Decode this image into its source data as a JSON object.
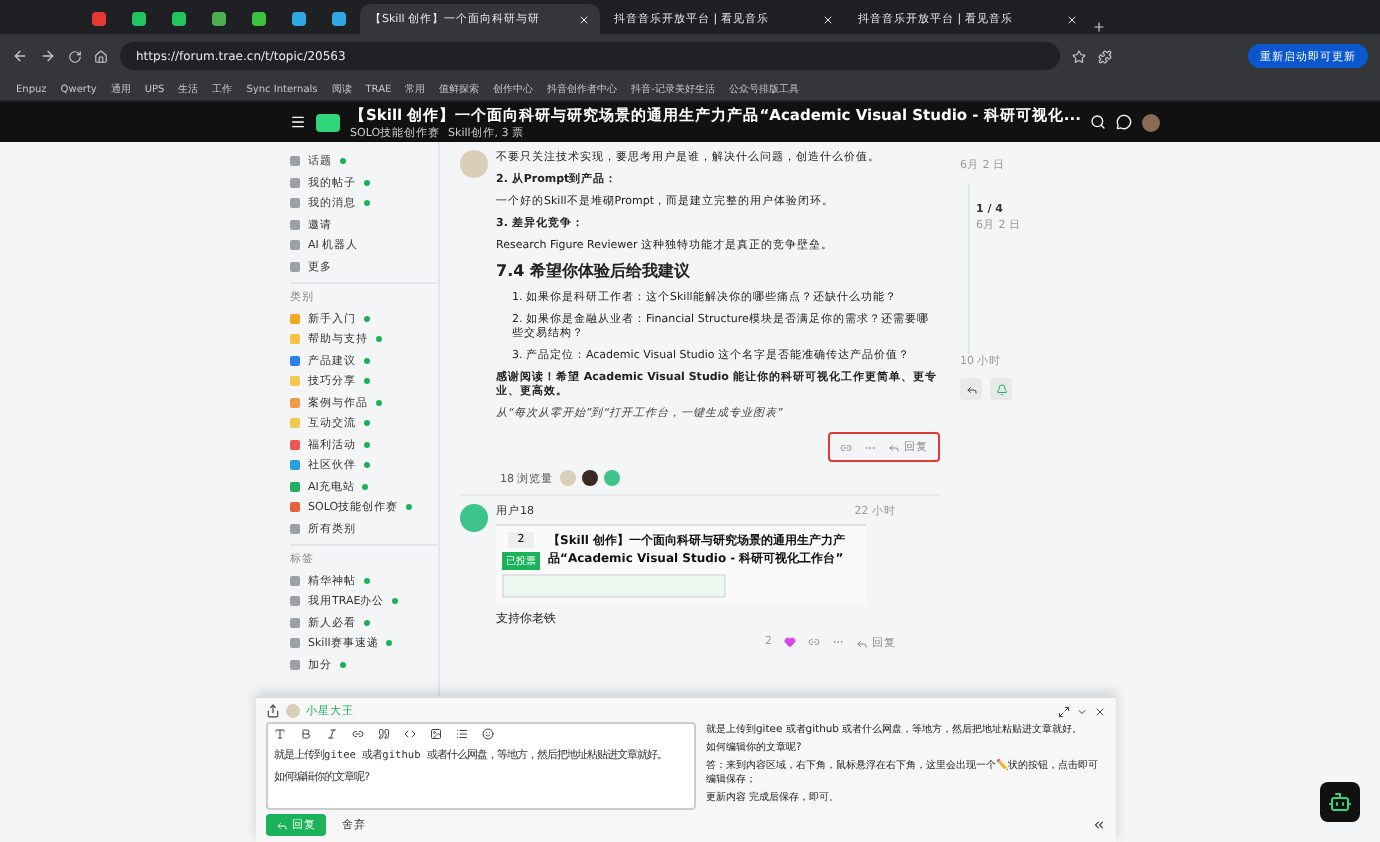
{
  "browser": {
    "pinned_tabs": [
      {
        "color": "#e53935"
      },
      {
        "color": "#22c55e"
      },
      {
        "color": "#22c55e"
      },
      {
        "color": "#4caf50"
      },
      {
        "color": "#3ec33e"
      },
      {
        "color": "#2fa7e0"
      },
      {
        "color": "#2fa7e0"
      }
    ],
    "tabs": [
      {
        "title": "【Skill 创作】一个面向科研与研",
        "selected": true
      },
      {
        "title": "抖音音乐开放平台 | 看见音乐",
        "selected": false
      },
      {
        "title": "抖音音乐开放平台 | 看见音乐",
        "selected": false
      }
    ],
    "url": "https://forum.trae.cn/t/topic/20563",
    "update_button": "重新启动即可更新",
    "bookmarks": [
      "Enpuz",
      "Qwerty",
      "通用",
      "UPS",
      "生活",
      "工作",
      "Sync Internals",
      "阅读",
      "TRAE",
      "常用",
      "值鲜探索",
      "创作中心",
      "抖音创作者中心",
      "抖音-记录美好生活",
      "公众号排版工具"
    ]
  },
  "header": {
    "title": "【Skill 创作】一个面向科研与研究场景的通用生产力产品“Academic Visual Studio - 科研可视化...",
    "category": "SOLO技能创作赛",
    "tags": "Skill创作, 3 票"
  },
  "sidebar": {
    "items": [
      {
        "label": "话题",
        "unread": true,
        "color": "#9aa0a6"
      },
      {
        "label": "我的帖子",
        "unread": true,
        "color": "#9aa0a6"
      },
      {
        "label": "我的消息",
        "unread": true,
        "color": "#9aa0a6"
      },
      {
        "label": "邀请",
        "unread": false,
        "color": "#9aa0a6"
      },
      {
        "label": "AI 机器人",
        "unread": false,
        "color": "#9aa0a6"
      },
      {
        "label": "更多",
        "unread": false,
        "color": "#9aa0a6"
      }
    ],
    "categories_heading": "类别",
    "categories": [
      {
        "label": "新手入门",
        "unread": true,
        "color": "#f5a623"
      },
      {
        "label": "帮助与支持",
        "unread": true,
        "color": "#f5c542"
      },
      {
        "label": "产品建议",
        "unread": true,
        "color": "#2f80ed"
      },
      {
        "label": "技巧分享",
        "unread": true,
        "color": "#f2c94c"
      },
      {
        "label": "案例与作品",
        "unread": true,
        "color": "#f2994a"
      },
      {
        "label": "互动交流",
        "unread": true,
        "color": "#f2c94c"
      },
      {
        "label": "福利活动",
        "unread": true,
        "color": "#eb5757"
      },
      {
        "label": "社区伙伴",
        "unread": true,
        "color": "#27a0e0"
      },
      {
        "label": "AI充电站",
        "unread": true,
        "color": "#27ae60"
      },
      {
        "label": "SOLO技能创作赛",
        "unread": true,
        "color": "#e8603c"
      },
      {
        "label": "所有类别",
        "unread": false,
        "color": "#9aa0a6"
      }
    ],
    "tags_heading": "标签",
    "tags": [
      {
        "label": "精华神帖",
        "unread": true
      },
      {
        "label": "我用TRAE办公",
        "unread": true
      },
      {
        "label": "新人必看",
        "unread": true
      },
      {
        "label": "Skill赛事速递",
        "unread": true
      },
      {
        "label": "加分",
        "unread": true
      }
    ]
  },
  "post": {
    "date": "6月 2 日",
    "paragraphs": [
      {
        "kind": "text",
        "text": "不要只关注技术实现，要思考用户是谁，解决什么问题，创造什么价值。"
      },
      {
        "kind": "bold",
        "text": "2. 从Prompt到产品："
      },
      {
        "kind": "text",
        "text": "一个好的Skill不是堆砌Prompt，而是建立完整的用户体验闭环。"
      },
      {
        "kind": "bold",
        "text": "3. 差异化竞争："
      },
      {
        "kind": "text",
        "text": "Research Figure Reviewer 这种独特功能才是真正的竞争壁垒。"
      },
      {
        "kind": "heading",
        "text": "7.4 希望你体验后给我建议"
      },
      {
        "kind": "list_item",
        "text": "1. 如果你是科研工作者：这个Skill能解决你的哪些痛点？还缺什么功能？"
      },
      {
        "kind": "list_item",
        "text": "2. 如果你是金融从业者：Financial Structure模块是否满足你的需求？还需要哪些交易结构？"
      },
      {
        "kind": "list_item",
        "text": "3. 产品定位：Academic Visual Studio 这个名字是否能准确传达产品价值？"
      },
      {
        "kind": "bold",
        "text": "感谢阅读！希望 Academic Visual Studio 能让你的科研可视化工作更简单、更专业、更高效。"
      },
      {
        "kind": "italic",
        "text": "从“每次从零开始”到“打开工作台，一键生成专业图表”"
      }
    ],
    "reply_label": "回复",
    "views": "18 浏览量"
  },
  "reply": {
    "user": "用户18",
    "time": "22 小时",
    "quote": {
      "votes": "2",
      "vote_button": "已投票",
      "title": "【Skill 创作】一个面向科研与研究场景的通用生产力产品“Academic Visual Studio - 科研可视化工作台”"
    },
    "text": "支持你老铁",
    "likes": "2",
    "reply_label": "回复"
  },
  "timeline": {
    "position": "1 / 4",
    "position_date": "6月 2 日",
    "bottom": "10 小时"
  },
  "composer": {
    "user": "小星大王",
    "editor_lines": [
      "就是上传到gitee 或者github 或者什么网盘，等地方，然后把地址粘贴进文章就好。",
      "如何编辑你的文章呢?"
    ],
    "preview_lines": [
      "就是上传到gitee 或者github 或者什么网盘，等地方，然后把地址粘贴进文章就好。",
      "如何编辑你的文章呢?",
      "答：来到内容区域，右下角，鼠标悬浮在右下角，这里会出现一个✏️状的按钮，点击即可编辑保存；",
      "更新内容 完成后保存，即可。"
    ],
    "submit": "回复",
    "discard": "舍弃"
  }
}
